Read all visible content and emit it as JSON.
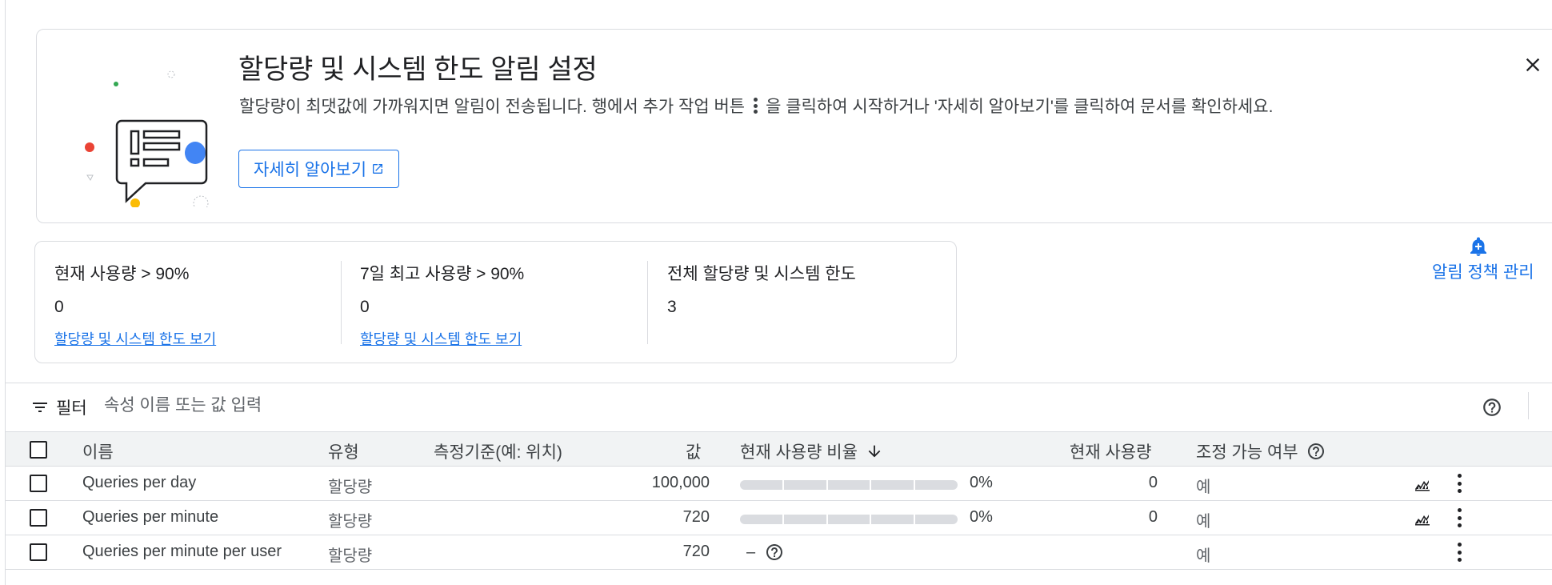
{
  "banner": {
    "title": "할당량 및 시스템 한도 알림 설정",
    "desc_before": "할당량이 최댓값에 가까워지면 알림이 전송됩니다. 행에서 추가 작업 버튼",
    "desc_after": "을 클릭하여 시작하거나 '자세히 알아보기'를 클릭하여 문서를 확인하세요.",
    "learn_more": "자세히 알아보기"
  },
  "summary": {
    "stats": [
      {
        "label": "현재 사용량 > 90%",
        "value": "0",
        "link": "할당량 및 시스템 한도 보기"
      },
      {
        "label": "7일 최고 사용량 > 90%",
        "value": "0",
        "link": "할당량 및 시스템 한도 보기"
      },
      {
        "label": "전체 할당량 및 시스템 한도",
        "value": "3"
      }
    ],
    "alert_policy": "알림 정책 관리"
  },
  "filter": {
    "label": "필터",
    "placeholder": "속성 이름 또는 값 입력"
  },
  "table": {
    "headers": {
      "name": "이름",
      "type": "유형",
      "dimension": "측정기준(예: 위치)",
      "value": "값",
      "usage_pct": "현재 사용량 비율",
      "usage": "현재 사용량",
      "adjustable": "조정 가능 여부"
    },
    "rows": [
      {
        "name": "Queries per day",
        "type": "할당량",
        "value": "100,000",
        "usage_pct": "0%",
        "usage": "0",
        "adjustable": "예"
      },
      {
        "name": "Queries per minute",
        "type": "할당량",
        "value": "720",
        "usage_pct": "0%",
        "usage": "0",
        "adjustable": "예"
      },
      {
        "name": "Queries per minute per user",
        "type": "할당량",
        "value": "720",
        "usage_pct": "–",
        "usage": "",
        "adjustable": "예"
      }
    ]
  },
  "colors": {
    "accent": "#1a73e8",
    "border": "#dadce0",
    "header_bg": "#f1f3f4"
  },
  "icons": [
    "close-icon",
    "open-in-new-icon",
    "bell-plus-icon",
    "filter-icon",
    "help-icon",
    "arrow-down-icon",
    "chart-icon",
    "more-vert-icon"
  ]
}
